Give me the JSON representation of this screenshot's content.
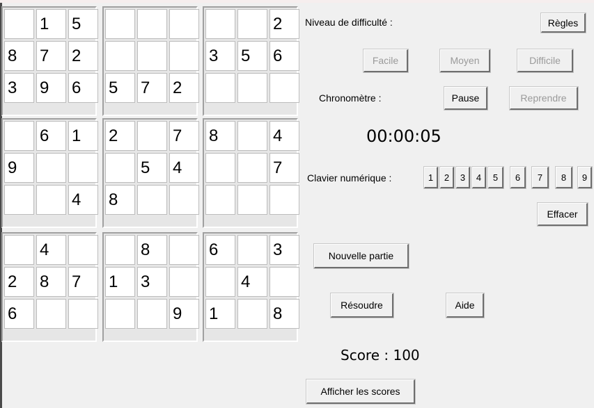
{
  "grid": [
    [
      "",
      "1",
      "5",
      "",
      "",
      "",
      "",
      "",
      "2"
    ],
    [
      "8",
      "7",
      "2",
      "",
      "",
      "",
      "3",
      "5",
      "6"
    ],
    [
      "3",
      "9",
      "6",
      "5",
      "7",
      "2",
      "",
      "",
      ""
    ],
    [
      "",
      "6",
      "1",
      "2",
      "",
      "7",
      "8",
      "",
      "4"
    ],
    [
      "9",
      "",
      "",
      "",
      "5",
      "4",
      "",
      "",
      "7"
    ],
    [
      "",
      "",
      "4",
      "8",
      "",
      "",
      "",
      "",
      ""
    ],
    [
      "",
      "4",
      "",
      "",
      "8",
      "",
      "6",
      "",
      "3"
    ],
    [
      "2",
      "8",
      "7",
      "1",
      "3",
      "",
      "",
      "4",
      ""
    ],
    [
      "6",
      "",
      "",
      "",
      "",
      "9",
      "1",
      "",
      "8"
    ]
  ],
  "difficulty": {
    "label": "Niveau de difficulté :",
    "rules_button": "Règles",
    "easy": "Facile",
    "medium": "Moyen",
    "hard": "Difficile"
  },
  "timer": {
    "label": "Chronomètre :",
    "pause": "Pause",
    "resume": "Reprendre",
    "value": "00:00:05"
  },
  "keypad": {
    "label": "Clavier numérique :",
    "keys": [
      "1",
      "2",
      "3",
      "4",
      "5",
      "6",
      "7",
      "8",
      "9"
    ],
    "erase": "Effacer"
  },
  "actions": {
    "new_game": "Nouvelle partie",
    "solve": "Résoudre",
    "help": "Aide"
  },
  "score": {
    "text": "Score : 100"
  },
  "show_scores": "Afficher les scores"
}
